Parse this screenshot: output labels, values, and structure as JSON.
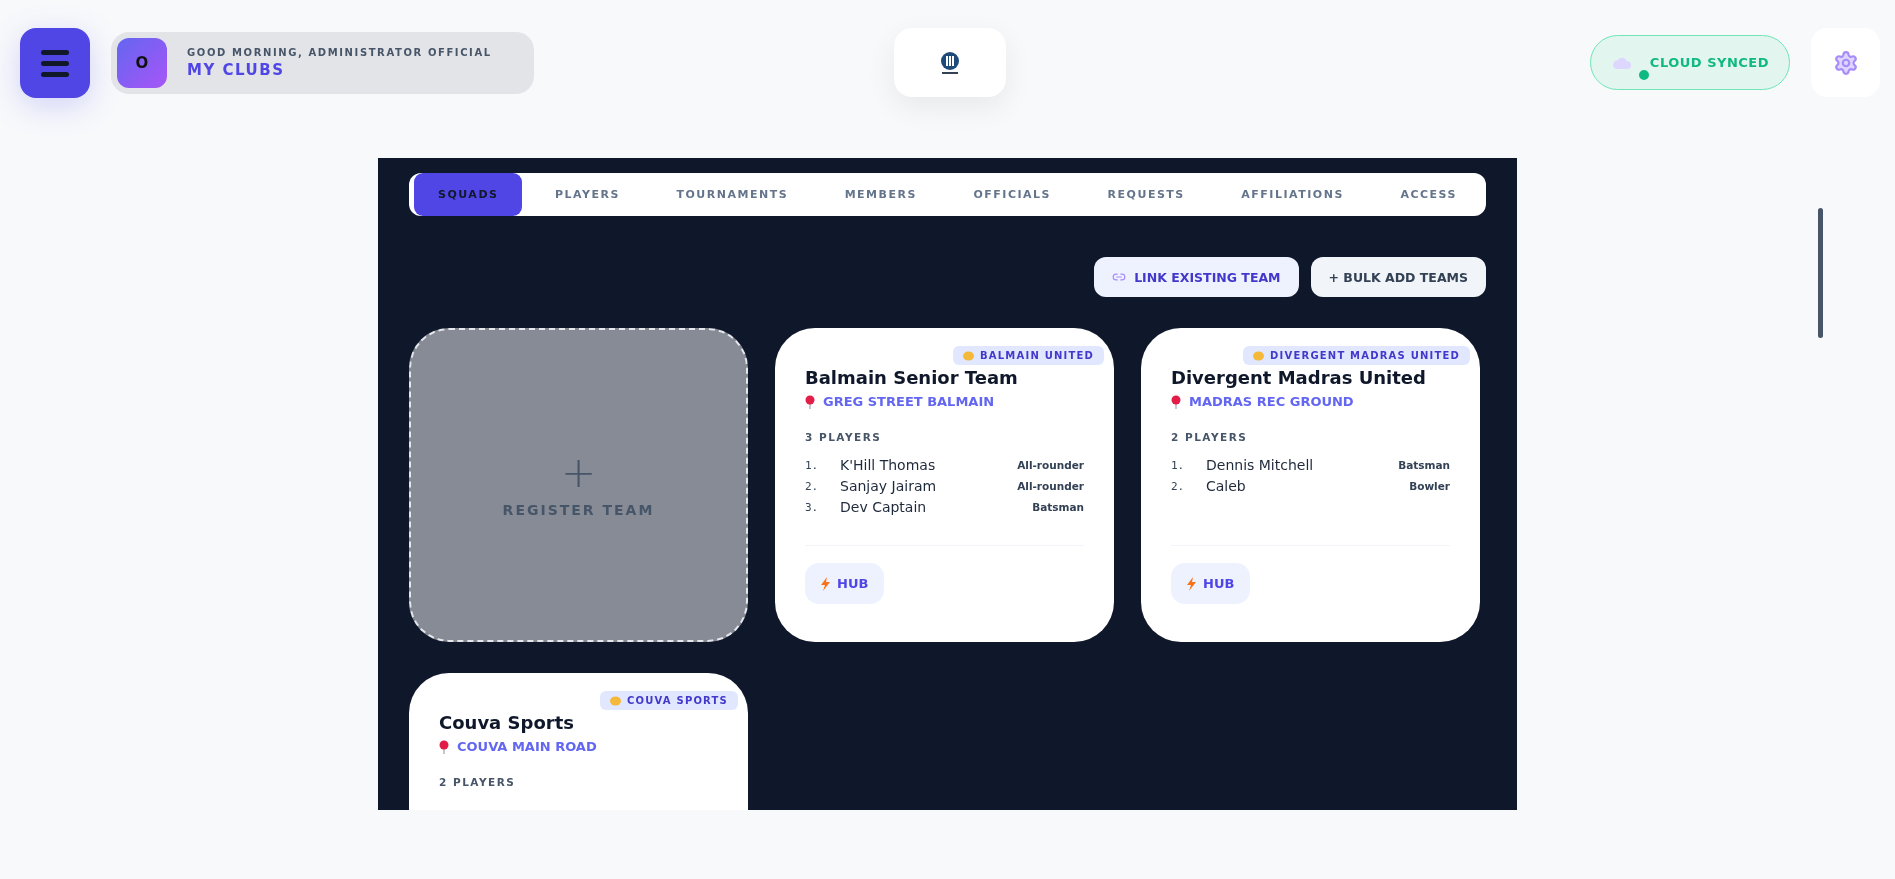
{
  "header": {
    "avatar": "O",
    "greeting": "GOOD MORNING, ADMINISTRATOR OFFICIAL",
    "title": "MY CLUBS",
    "sync": {
      "label": "CLOUD SYNCED",
      "online": true
    }
  },
  "tabs": [
    {
      "label": "SQUADS",
      "selected": true
    },
    {
      "label": "PLAYERS",
      "selected": false
    },
    {
      "label": "TOURNAMENTS",
      "selected": false
    },
    {
      "label": "MEMBERS",
      "selected": false
    },
    {
      "label": "OFFICIALS",
      "selected": false
    },
    {
      "label": "REQUESTS",
      "selected": false
    },
    {
      "label": "AFFILIATIONS",
      "selected": false
    },
    {
      "label": "ACCESS",
      "selected": false
    }
  ],
  "actions": [
    {
      "kind": "link",
      "label": "LINK EXISTING TEAM"
    },
    {
      "kind": "bulk",
      "label": "+ BULK ADD TEAMS"
    }
  ],
  "register": {
    "plus": "+",
    "label": "REGISTER TEAM"
  },
  "teams": [
    {
      "name": "Balmain Senior Team",
      "club": "BALMAIN UNITED",
      "ground": "GREG STREET BALMAIN",
      "count": "3 PLAYERS",
      "players": [
        {
          "no": "1.",
          "name": "K'Hill Thomas",
          "role": "All-rounder"
        },
        {
          "no": "2.",
          "name": "Sanjay Jairam",
          "role": "All-rounder"
        },
        {
          "no": "3.",
          "name": "Dev Captain",
          "role": "Batsman"
        }
      ],
      "hub": "HUB"
    },
    {
      "name": "Divergent Madras United",
      "club": "DIVERGENT MADRAS UNITED",
      "ground": "MADRAS REC GROUND",
      "count": "2 PLAYERS",
      "players": [
        {
          "no": "1.",
          "name": "Dennis Mitchell",
          "role": "Batsman"
        },
        {
          "no": "2.",
          "name": "Caleb",
          "role": "Bowler"
        }
      ],
      "hub": "HUB"
    },
    {
      "name": "Couva Sports",
      "club": "COUVA SPORTS",
      "ground": "COUVA MAIN ROAD",
      "count": "2 PLAYERS"
    }
  ]
}
